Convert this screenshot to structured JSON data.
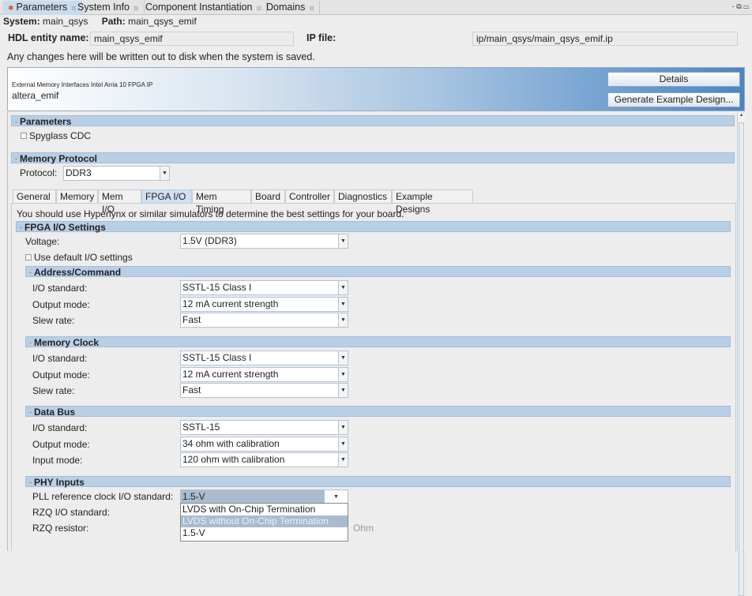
{
  "tabs": [
    {
      "label": "Parameters",
      "active": true
    },
    {
      "label": "System Info"
    },
    {
      "label": "Component Instantiation"
    },
    {
      "label": "Domains"
    }
  ],
  "window_controls": "- ⧉ ▭",
  "system": {
    "system_label": "System:",
    "system_value": "main_qsys",
    "path_label": "Path:",
    "path_value": "main_qsys_emif"
  },
  "hdl": {
    "label": "HDL entity name:",
    "value": "main_qsys_emif",
    "ip_label": "IP file:",
    "ip_value": "ip/main_qsys/main_qsys_emif.ip"
  },
  "notice": "Any changes here will be written out to disk when the system is saved.",
  "banner": {
    "subtitle": "External Memory Interfaces Intel Arria 10 FPGA IP",
    "name": "altera_emif",
    "details_button": "Details",
    "generate_button": "Generate Example Design..."
  },
  "parameters": {
    "header": "Parameters",
    "spyglass": "Spyglass CDC"
  },
  "memory_protocol": {
    "header": "Memory Protocol",
    "protocol_label": "Protocol:",
    "protocol_value": "DDR3"
  },
  "param_tabs": [
    "General",
    "Memory",
    "Mem I/O",
    "FPGA I/O",
    "Mem Timing",
    "Board",
    "Controller",
    "Diagnostics",
    "Example Designs"
  ],
  "active_param_tab": "FPGA I/O",
  "hint": "You should use Hyperlynx or similar simulators to determine the best settings for your board.",
  "fpga_io": {
    "header": "FPGA I/O Settings",
    "voltage_label": "Voltage:",
    "voltage_value": "1.5V (DDR3)",
    "use_default": "Use default I/O settings"
  },
  "sections": [
    {
      "header": "Address/Command",
      "rows": [
        {
          "label": "I/O standard:",
          "value": "SSTL-15 Class I"
        },
        {
          "label": "Output mode:",
          "value": "12 mA current strength"
        },
        {
          "label": "Slew rate:",
          "value": "Fast"
        }
      ]
    },
    {
      "header": "Memory Clock",
      "rows": [
        {
          "label": "I/O standard:",
          "value": "SSTL-15 Class I"
        },
        {
          "label": "Output mode:",
          "value": "12 mA current strength"
        },
        {
          "label": "Slew rate:",
          "value": "Fast"
        }
      ]
    },
    {
      "header": "Data Bus",
      "rows": [
        {
          "label": "I/O standard:",
          "value": "SSTL-15"
        },
        {
          "label": "Output mode:",
          "value": "34 ohm with calibration"
        },
        {
          "label": "Input mode:",
          "value": "120 ohm with calibration"
        }
      ]
    }
  ],
  "phy": {
    "header": "PHY Inputs",
    "pll_label": "PLL reference clock I/O standard:",
    "pll_value": "1.5-V",
    "rzq_std_label": "RZQ I/O standard:",
    "rzq_res_label": "RZQ resistor:",
    "rzq_unit": "Ohm",
    "dropdown_options": [
      "LVDS with On-Chip Termination",
      "LVDS without On-Chip Termination",
      "1.5-V"
    ],
    "highlighted_option": 1
  }
}
